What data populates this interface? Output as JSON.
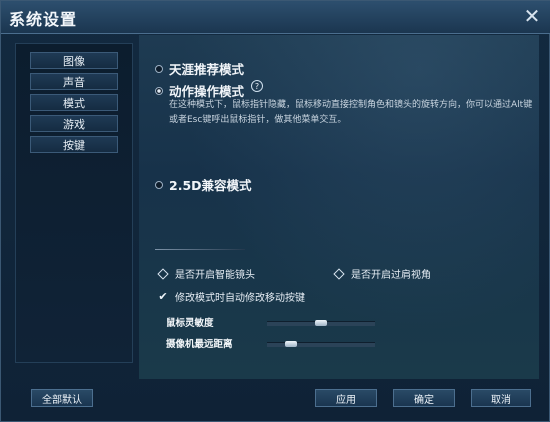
{
  "window": {
    "title": "系统设置"
  },
  "nav": {
    "items": [
      "图像",
      "声音",
      "模式",
      "游戏",
      "按键"
    ]
  },
  "modes": {
    "option1": "天涯推荐模式",
    "option2": "动作操作模式",
    "option2_desc": "在这种模式下，鼠标指针隐藏，鼠标移动直接控制角色和镜头的旋转方向，你可以通过Alt键或者Esc键呼出鼠标指针，做其他菜单交互。",
    "option3": "2.5D兼容模式"
  },
  "options": {
    "smart_camera": "是否开启智能镜头",
    "over_shoulder": "是否开启过肩视角",
    "auto_modify_move": "修改模式时自动修改移动按键"
  },
  "sliders": {
    "mouse_sensitivity": {
      "label": "鼠标灵敏度",
      "value": 0.5
    },
    "camera_distance": {
      "label": "摄像机最远距离",
      "value": 0.25
    }
  },
  "buttons": {
    "all_default": "全部默认",
    "apply": "应用",
    "ok": "确定",
    "cancel": "取消"
  }
}
